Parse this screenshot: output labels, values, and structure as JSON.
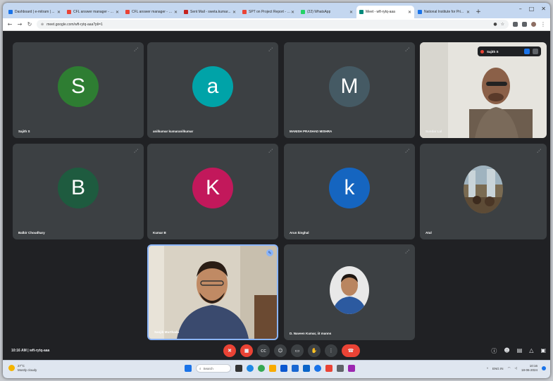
{
  "browser": {
    "tabs": [
      {
        "label": "Dashboard | e-mitram | ...",
        "color": "#1a73e8",
        "active": false
      },
      {
        "label": "CFL answer manager - Go...",
        "color": "#ea4335",
        "active": false
      },
      {
        "label": "CFL answer manager - Go...",
        "color": "#ea4335",
        "active": false
      },
      {
        "label": "Sent Mail - sweta.kumar...",
        "color": "#c5221f",
        "active": false
      },
      {
        "label": "SPT on Project Report - G...",
        "color": "#ea4335",
        "active": false
      },
      {
        "label": "(22) WhatsApp",
        "color": "#25d366",
        "active": false
      },
      {
        "label": "Meet - wft-rytq-aaa",
        "color": "#00897b",
        "active": true
      },
      {
        "label": "National Institute for Pri...",
        "color": "#1a73e8",
        "active": false
      }
    ],
    "new_tab": "+",
    "url": "meet.google.com/wft-rytq-aaa?pli=1",
    "window_controls": [
      "–",
      "□",
      "✕"
    ]
  },
  "meeting": {
    "participants": [
      {
        "name": "Sajith S",
        "initial": "S",
        "color": "#2e7d32"
      },
      {
        "name": "anilkumar kumaranilkumar",
        "initial": "a",
        "color": "#00a3a8"
      },
      {
        "name": "MANISH PRASHAD MISHRA",
        "initial": "M",
        "color": "#455a64"
      },
      {
        "name": "Sundar Lal",
        "initial": "",
        "color": ""
      },
      {
        "name": "Balbir Choudhary",
        "initial": "B",
        "color": "#1e5b3f"
      },
      {
        "name": "Kumar B",
        "initial": "K",
        "color": "#c2185b"
      },
      {
        "name": "Arun kinghal",
        "initial": "k",
        "color": "#1565c0"
      },
      {
        "name": "Atul",
        "initial": "",
        "color": ""
      },
      {
        "name": "Sanjib Murthada",
        "initial": "",
        "color": ""
      },
      {
        "name": "D. Naveen Kumar, iit manns",
        "initial": "",
        "color": ""
      }
    ],
    "recording_label": "Sajith S",
    "info": "10:16 AM  |  wft-rytq-aaa"
  },
  "controls": {
    "buttons": [
      {
        "icon": "mic-off-icon",
        "glyph": "✖",
        "red": true
      },
      {
        "icon": "camera-off-icon",
        "glyph": "■",
        "red": true
      },
      {
        "icon": "captions-icon",
        "glyph": "cc",
        "red": false
      },
      {
        "icon": "emoji-icon",
        "glyph": "☺",
        "red": false
      },
      {
        "icon": "present-icon",
        "glyph": "▭",
        "red": false
      },
      {
        "icon": "raise-hand-icon",
        "glyph": "✋",
        "red": false
      },
      {
        "icon": "more-options-icon",
        "glyph": "⋮",
        "red": false
      }
    ],
    "leave_glyph": "☎",
    "right": [
      {
        "icon": "info-icon",
        "glyph": "ⓘ"
      },
      {
        "icon": "people-icon",
        "glyph": "☻"
      },
      {
        "icon": "chat-icon",
        "glyph": "▤"
      },
      {
        "icon": "activities-icon",
        "glyph": "△"
      },
      {
        "icon": "lock-icon",
        "glyph": "▣"
      }
    ]
  },
  "taskbar": {
    "weather_temp": "27°C",
    "weather_text": "Mostly cloudy",
    "search_placeholder": "Search",
    "time": "10:16",
    "date": "18-06-2024",
    "lang": "ENG IN"
  }
}
